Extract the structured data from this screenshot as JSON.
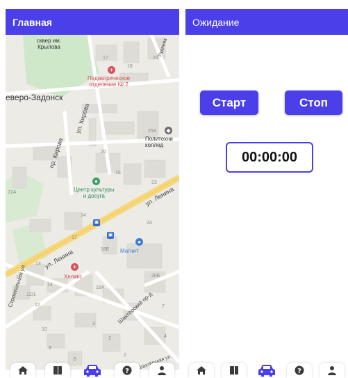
{
  "left_screen": {
    "title": "Главная",
    "map": {
      "labels": {
        "square": "сквер им.\nКрылова",
        "pediatric": "Педиатрическое\nотделение № 2",
        "town": "еверо-Задонск",
        "kirova_street": "ул. Кирова",
        "kirova_lane": "пр. Кирова",
        "polytech": "Политехни\nколлед",
        "culture": "Центр культуры\nи досуга",
        "lenina_upper": "ул. Ленина",
        "lenina_lower": "ул. Ленина",
        "magnit": "Магнит",
        "heliks": "Хеликс",
        "shakhterskiy": "Шахтёрский пр-д",
        "stroitelnaya": "Строительная ул.",
        "shakhterskaya": "Шахтёрская ул.",
        "rudneva": "Руднева"
      },
      "house_numbers": [
        "17",
        "18",
        "23",
        "25А",
        "20",
        "16",
        "23",
        "22А",
        "14",
        "24",
        "17",
        "18Б",
        "18А",
        "13",
        "14",
        "11",
        "12/1",
        "12",
        "10",
        "8",
        "6",
        "3",
        "2",
        "1",
        "20Б",
        "7",
        "4"
      ]
    },
    "nav": {
      "home": "home-icon",
      "book": "book-icon",
      "car": "car-icon",
      "help": "help-icon",
      "profile": "profile-icon"
    }
  },
  "right_screen": {
    "title": "Ожидание",
    "start_label": "Старт",
    "stop_label": "Стоп",
    "timer": "00:00:00"
  },
  "colors": {
    "accent": "#4a3fe8",
    "map_bg": "#ecebe6",
    "road": "#f7d77a",
    "park": "#cfe8c9"
  }
}
